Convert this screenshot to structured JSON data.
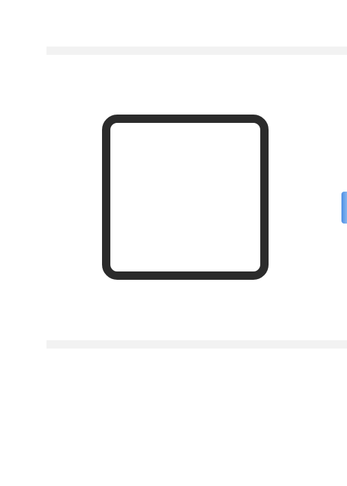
{
  "checkbox": {
    "checked": false
  },
  "colors": {
    "checkbox_border": "#2b2b2b",
    "divider": "#f2f2f2",
    "edge_accent": "#4f8fe3",
    "background": "#ffffff"
  }
}
